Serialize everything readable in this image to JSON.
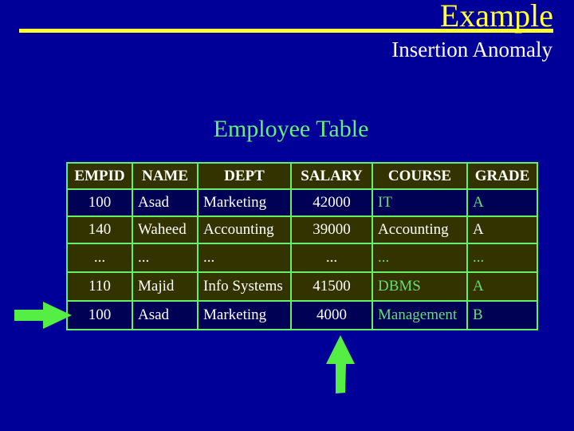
{
  "slide": {
    "title": "Example",
    "subtitle": "Insertion Anomaly",
    "table_title": "Employee Table"
  },
  "table": {
    "headers": [
      "EMPID",
      "NAME",
      "DEPT",
      "SALARY",
      "COURSE",
      "GRADE"
    ],
    "rows": [
      [
        "100",
        "Asad",
        "Marketing",
        "42000",
        "IT",
        "A"
      ],
      [
        "140",
        "Waheed",
        "Accounting",
        "39000",
        "Accounting",
        "A"
      ],
      [
        "...",
        "...",
        "...",
        "...",
        "...",
        "..."
      ],
      [
        "110",
        "Majid",
        "Info Systems",
        "41500",
        "DBMS",
        "A"
      ],
      [
        "100",
        "Asad",
        "Marketing",
        "4000",
        "Management",
        "B"
      ]
    ]
  },
  "annotations": {
    "right_arrow": "arrow-right-icon",
    "up_arrow": "arrow-up-icon"
  },
  "colors": {
    "background": "#000099",
    "title": "#ffff33",
    "accent_green": "#66ee66"
  }
}
